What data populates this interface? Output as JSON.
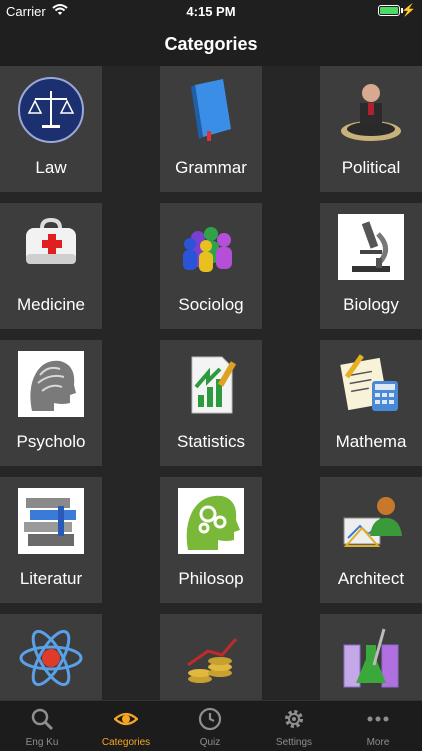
{
  "status_bar": {
    "carrier": "Carrier",
    "time": "4:15 PM"
  },
  "nav": {
    "title": "Categories"
  },
  "categories": [
    {
      "label": "Law",
      "icon": "scales-icon"
    },
    {
      "label": "Grammar",
      "icon": "book-icon"
    },
    {
      "label": "Political",
      "icon": "politician-icon"
    },
    {
      "label": "Medicine",
      "icon": "first-aid-kit-icon"
    },
    {
      "label": "Sociolog",
      "icon": "people-group-icon"
    },
    {
      "label": "Biology",
      "icon": "microscope-icon"
    },
    {
      "label": "Psycholo",
      "icon": "head-profile-icon"
    },
    {
      "label": "Statistics",
      "icon": "chart-document-icon"
    },
    {
      "label": "Mathema",
      "icon": "calculator-icon"
    },
    {
      "label": "Literatur",
      "icon": "books-stack-icon"
    },
    {
      "label": "Philosop",
      "icon": "gear-head-icon"
    },
    {
      "label": "Architect",
      "icon": "architect-icon"
    },
    {
      "label": "",
      "icon": "atom-icon"
    },
    {
      "label": "",
      "icon": "coins-icon"
    },
    {
      "label": "",
      "icon": "flask-icon"
    }
  ],
  "tabs": [
    {
      "label": "Eng Ku",
      "icon": "search-icon",
      "active": false
    },
    {
      "label": "Categories",
      "icon": "eye-icon",
      "active": true
    },
    {
      "label": "Quiz",
      "icon": "clock-icon",
      "active": false
    },
    {
      "label": "Settings",
      "icon": "gear-icon",
      "active": false
    },
    {
      "label": "More",
      "icon": "more-icon",
      "active": false
    }
  ],
  "colors": {
    "accent": "#f5a623",
    "tile": "#3d3d3d",
    "background": "#1f1f1f"
  }
}
